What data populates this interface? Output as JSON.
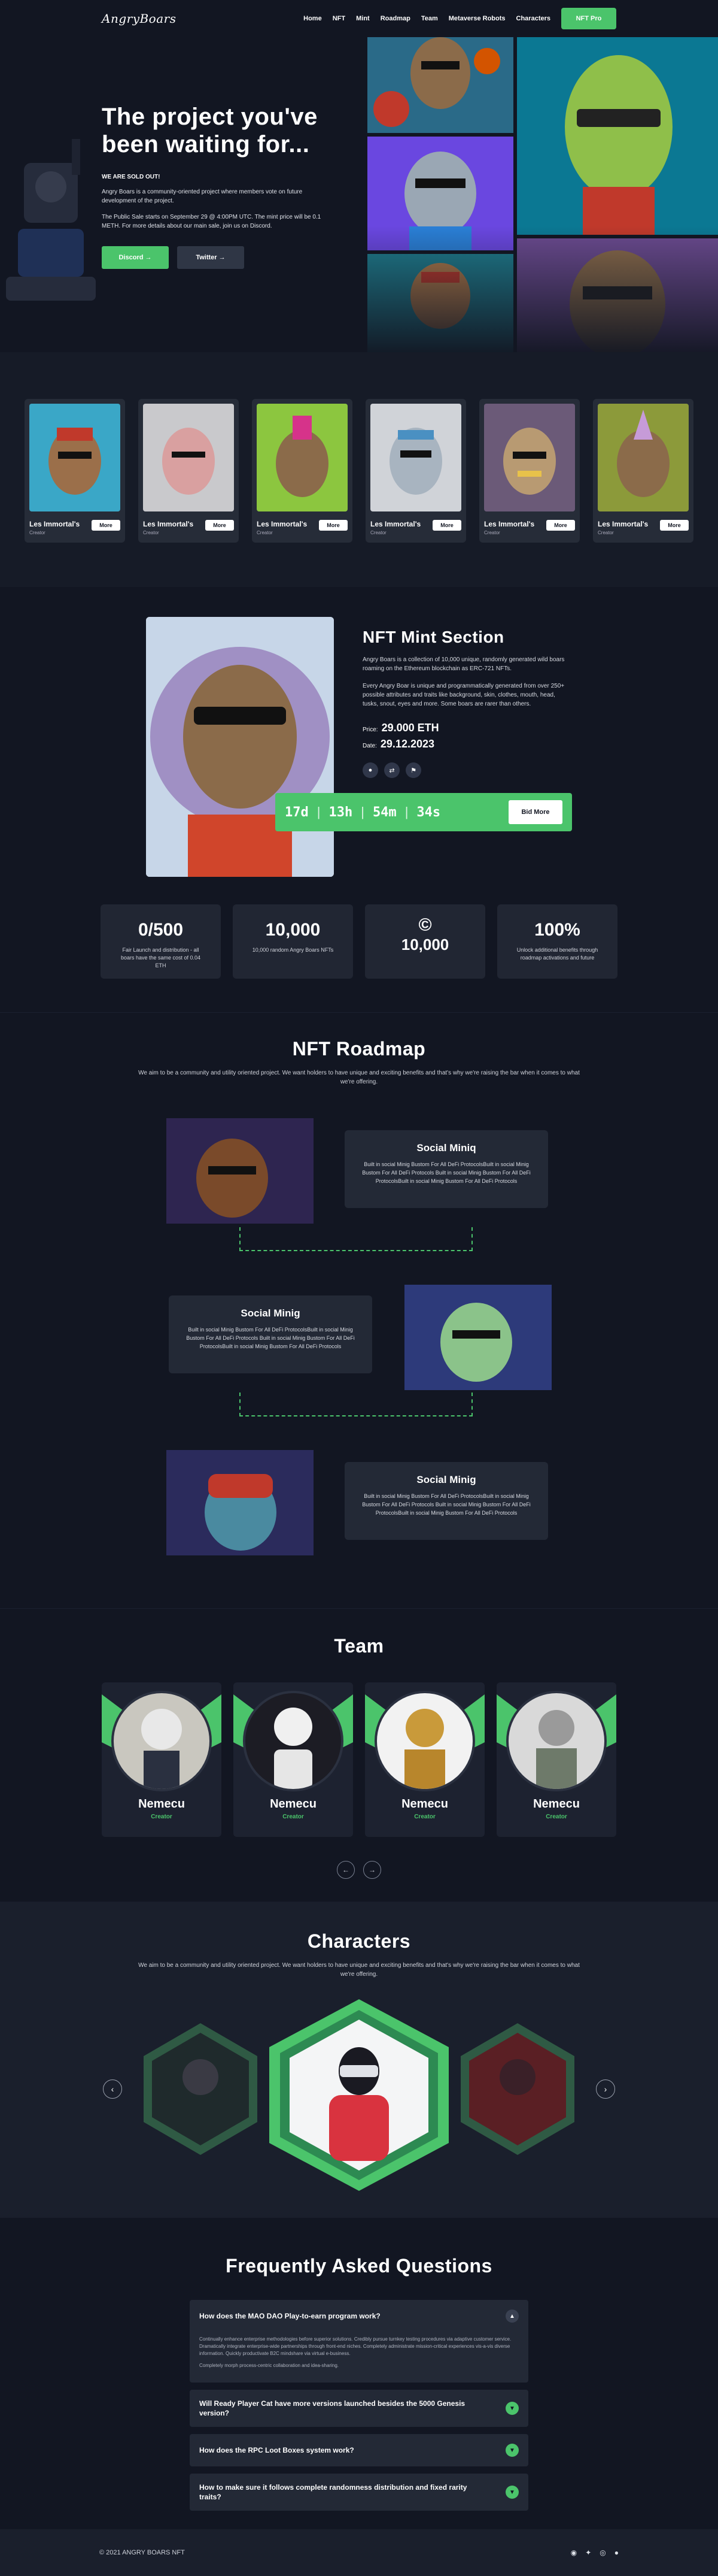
{
  "nav": {
    "logo": "AngryBoars",
    "links": [
      "Home",
      "NFT",
      "Mint",
      "Roadmap",
      "Team",
      "Metaverse Robots",
      "Characters"
    ],
    "cta": "NFT Pro"
  },
  "hero": {
    "title": "The project you've been waiting for...",
    "sold": "WE ARE SOLD OUT!",
    "p1": "Angry Boars is a community-oriented project where members vote on future development of the project.",
    "p2": "The Public Sale starts on September 29 @ 4:00PM UTC. The mint price will be 0.1 METH. For more details about our main sale, join us on Discord.",
    "btn_discord": "Discord →",
    "btn_twitter": "Twitter →"
  },
  "cards": [
    {
      "title": "Les Immortal's",
      "sub": "Creator",
      "btn": "More"
    },
    {
      "title": "Les Immortal's",
      "sub": "Creator",
      "btn": "More"
    },
    {
      "title": "Les Immortal's",
      "sub": "Creator",
      "btn": "More"
    },
    {
      "title": "Les Immortal's",
      "sub": "Creator",
      "btn": "More"
    },
    {
      "title": "Les Immortal's",
      "sub": "Creator",
      "btn": "More"
    },
    {
      "title": "Les Immortal's",
      "sub": "Creator",
      "btn": "More"
    }
  ],
  "mint": {
    "title": "NFT Mint Section",
    "p1": "Angry Boars is a collection of 10,000 unique, randomly generated wild boars roaming on the Ethereum blockchain as ERC-721 NFTs.",
    "p2": "Every Angry Boar is unique and programmatically generated from over 250+ possible attributes and traits like background, skin, clothes, mouth, head, tusks, snout, eyes and more. Some boars are rarer than others.",
    "price_label": "Price:",
    "price_value": "29.000 ETH",
    "date_label": "Date:",
    "date_value": "29.12.2023",
    "timer": {
      "d": "17d",
      "h": "13h",
      "m": "54m",
      "s": "34s"
    },
    "bid_btn": "Bid More"
  },
  "stats": [
    {
      "value": "0/500",
      "text": "Fair Launch and distribution - all boars have the same cost of 0.04 ETH"
    },
    {
      "value": "10,000",
      "text": "10,000 random Angry Boars NFTs"
    },
    {
      "value": "10,000",
      "text": ""
    },
    {
      "value": "100%",
      "text": "Unlock additional benefits through roadmap activations and future"
    }
  ],
  "roadmap": {
    "title": "NFT Roadmap",
    "sub": "We aim to be a community and utility oriented project. We want holders to have unique and exciting benefits and that's why we're raising the bar when it comes to what we're offering.",
    "items": [
      {
        "title": "Social Miniq",
        "text": "Built in social Minig Bustom For All DeFi ProtocolsBuilt in social Minig Bustom For All DeFi Protocols Built in social Minig Bustom For All DeFi ProtocolsBuilt in social Minig Bustom For All DeFi Protocols"
      },
      {
        "title": "Social Minig",
        "text": "Built in social Minig Bustom For All DeFi ProtocolsBuilt in social Minig Bustom For All DeFi Protocols Built in social Minig Bustom For All DeFi ProtocolsBuilt in social Minig Bustom For All DeFi Protocols"
      },
      {
        "title": "Social Minig",
        "text": "Built in social Minig Bustom For All DeFi ProtocolsBuilt in social Minig Bustom For All DeFi Protocols Built in social Minig Bustom For All DeFi ProtocolsBuilt in social Minig Bustom For All DeFi Protocols"
      }
    ]
  },
  "team": {
    "title": "Team",
    "members": [
      {
        "name": "Nemecu",
        "role": "Creator"
      },
      {
        "name": "Nemecu",
        "role": "Creator"
      },
      {
        "name": "Nemecu",
        "role": "Creator"
      },
      {
        "name": "Nemecu",
        "role": "Creator"
      }
    ]
  },
  "characters": {
    "title": "Characters",
    "sub": "We aim to be a community and utility oriented project. We want holders to have unique and exciting benefits and that's why we're raising the bar when it comes to what we're offering."
  },
  "faq": {
    "title": "Frequently Asked Questions",
    "items": [
      {
        "q": "How does the MAO DAO Play-to-earn program work?",
        "a1": "Continually enhance enterprise methodologies before superior solutions. Credibly pursue turnkey testing procedures via adaptive customer service. Dramatically integrate enterprise-wide partnerships through front-end niches. Completely administrate mission-critical experiences vis-a-vis diverse information. Quickly productivate B2C mindshare via virtual e-business.",
        "a2": "Completely morph process-centric collaboration and idea-sharing."
      },
      {
        "q": "Will Ready Player Cat have more versions launched besides the 5000 Genesis version?"
      },
      {
        "q": "How does the RPC Loot Boxes system work?"
      },
      {
        "q": "How to make sure it follows complete randomness distribution and fixed rarity traits?"
      }
    ]
  },
  "footer": {
    "copy": "© 2021 ANGRY BOARS NFT"
  }
}
